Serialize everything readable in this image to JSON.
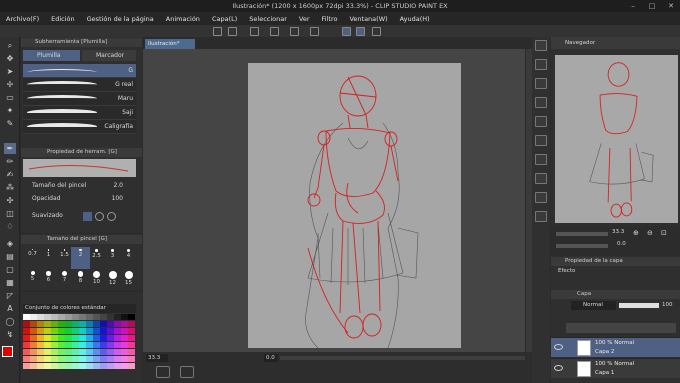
{
  "window": {
    "title": "Ilustración* (1200 x 1600px 72dpi 33.3%)  - CLIP STUDIO PAINT EX"
  },
  "menu": [
    "Archivo(F)",
    "Edición",
    "Gestión de la página",
    "Animación",
    "Capa(L)",
    "Seleccionar",
    "Ver",
    "Filtro",
    "Ventana(W)",
    "Ayuda(H)"
  ],
  "subtool": {
    "panel_title": "Subherramienta [Plumilla]",
    "tabs": [
      "Plumilla",
      "Marcador"
    ],
    "brushes": [
      "G",
      "G real",
      "Maru",
      "Saji",
      "Caligrafía"
    ]
  },
  "tool_property": {
    "title": "Propiedad de herram. [G]",
    "brush_size_label": "Tamaño del pincel",
    "brush_size_value": "2.0",
    "opacity_label": "Opacidad",
    "opacity_value": "100",
    "smoothing_label": "Suavizado"
  },
  "brush_size_panel": {
    "title": "Tamaño del pincel [G]",
    "sizes": [
      "0.7",
      "1",
      "1.5",
      "2",
      "2.5",
      "3",
      "4",
      "5",
      "6",
      "7",
      "8",
      "10",
      "12",
      "15"
    ],
    "selected": "2"
  },
  "color_panel": {
    "set_name": "Conjunto de colores estándar",
    "main_color": "#e00000",
    "sub_color": "#ffffff"
  },
  "document": {
    "tab": "Ilustración*",
    "zoom": "33.3",
    "scroll_pos": "0.0"
  },
  "navigator": {
    "title": "Navegador",
    "zoom": "33.3",
    "angle": "0.0"
  },
  "layer_property": {
    "title": "Propiedad de la capa",
    "effect_label": "Efecto"
  },
  "layers_panel": {
    "title": "Capa",
    "blend": "Normal",
    "opacity": "100",
    "layers": [
      {
        "mode": "100 % Normal",
        "name": "Capa 2",
        "selected": true
      },
      {
        "mode": "100 % Normal",
        "name": "Capa 1",
        "selected": false
      }
    ]
  },
  "colors": {
    "accent": "#4e6184",
    "sketch_red": "#d42020",
    "paper": "#a6a6a6"
  }
}
